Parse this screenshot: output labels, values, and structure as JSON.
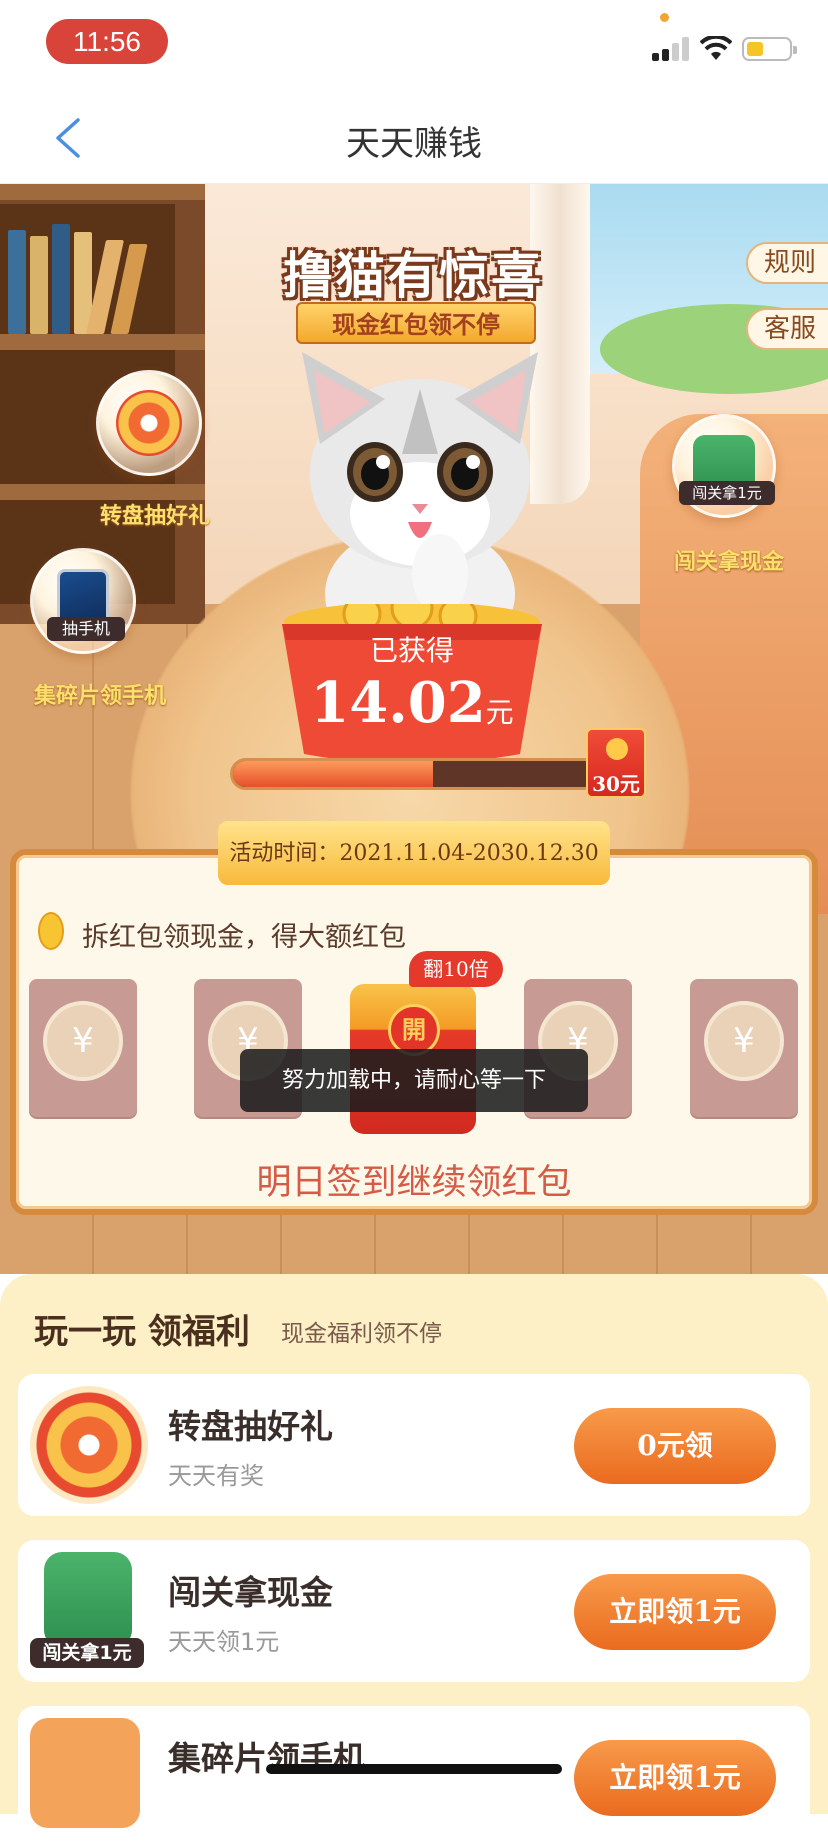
{
  "status_bar": {
    "time": "11:56"
  },
  "nav": {
    "title": "天天赚钱"
  },
  "hero": {
    "banner_title": "撸猫有惊喜",
    "banner_ribbon": "现金红包领不停",
    "side_buttons": [
      "规则",
      "客服"
    ],
    "bubbles": [
      {
        "label": "转盘抽好礼",
        "icon": "spin-wheel-icon"
      },
      {
        "label": "闯关拿现金",
        "icon": "level-cash-icon",
        "icon_caption": "闯关拿1元"
      },
      {
        "label": "集碎片领手机",
        "icon": "phone-icon",
        "icon_caption": "抽手机"
      }
    ],
    "earned_label": "已获得",
    "earned_amount": "14.02",
    "earned_unit": "元",
    "progress": 0.55,
    "prize_label": "30元"
  },
  "signin_card": {
    "date_label": "活动时间：",
    "date_value": "2021.11.04-2030.12.30",
    "hint": "拆红包领现金，得大额红包",
    "envelope_symbol": "¥",
    "active_envelope_seal": "開",
    "double_badge": "翻10倍",
    "cta": "明日签到继续领红包"
  },
  "toast": "努力加载中，请耐心等一下",
  "welfare": {
    "title": "玩一玩 领福利",
    "subtitle": "现金福利领不停",
    "items": [
      {
        "title": "转盘抽好礼",
        "subtitle": "天天有奖",
        "button": "0元领",
        "icon": "spin-wheel-icon"
      },
      {
        "title": "闯关拿现金",
        "subtitle": "天天领1元",
        "button": "立即领1元",
        "icon": "level-cash-icon",
        "icon_caption": "闯关拿1元"
      },
      {
        "title": "集碎片领手机",
        "subtitle": "",
        "button": "立即领1元",
        "icon": "phone-icon"
      }
    ]
  },
  "colors": {
    "accent": "#ea6b1f",
    "red": "#d9443a",
    "cream": "#fdf0c6"
  }
}
